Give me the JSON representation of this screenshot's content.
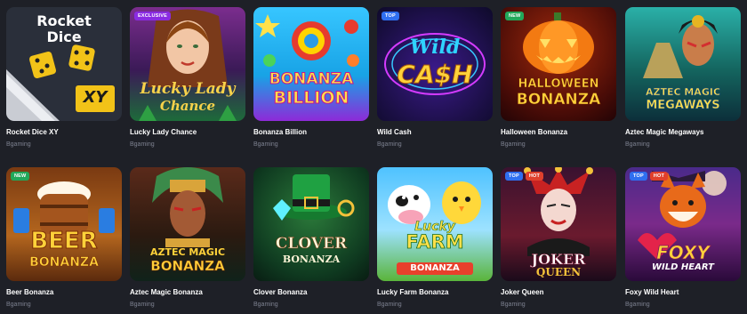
{
  "games": [
    {
      "title": "Rocket Dice XY",
      "provider": "Bgaming",
      "badges": [],
      "art": {
        "line1": "Rocket",
        "line2": "Dice",
        "line3": "XY"
      }
    },
    {
      "title": "Lucky Lady Chance",
      "provider": "Bgaming",
      "badges": [
        "EXCLUSIVE"
      ],
      "art": {
        "line1": "Lucky Lady",
        "line2": "Chance"
      }
    },
    {
      "title": "Bonanza Billion",
      "provider": "Bgaming",
      "badges": [],
      "art": {
        "line1": "BONANZA",
        "line2": "BILLION"
      }
    },
    {
      "title": "Wild Cash",
      "provider": "Bgaming",
      "badges": [
        "TOP"
      ],
      "art": {
        "line1": "Wild",
        "line2": "CA$H"
      }
    },
    {
      "title": "Halloween Bonanza",
      "provider": "Bgaming",
      "badges": [
        "NEW"
      ],
      "art": {
        "line1": "HALLOWEEN",
        "line2": "BONANZA"
      }
    },
    {
      "title": "Aztec Magic Megaways",
      "provider": "Bgaming",
      "badges": [],
      "art": {
        "line1": "AZTEC MAGIC",
        "line2": "MEGAWAYS"
      }
    },
    {
      "title": "Beer Bonanza",
      "provider": "Bgaming",
      "badges": [
        "NEW"
      ],
      "art": {
        "line1": "BEER",
        "line2": "BONANZA"
      }
    },
    {
      "title": "Aztec Magic Bonanza",
      "provider": "Bgaming",
      "badges": [],
      "art": {
        "line1": "AZTEC MAGIC",
        "line2": "BONANZA"
      }
    },
    {
      "title": "Clover Bonanza",
      "provider": "Bgaming",
      "badges": [],
      "art": {
        "line1": "CLOVER",
        "line2": "BONANZA"
      }
    },
    {
      "title": "Lucky Farm Bonanza",
      "provider": "Bgaming",
      "badges": [],
      "art": {
        "line1": "Lucky",
        "line2": "FARM",
        "line3": "BONANZA"
      }
    },
    {
      "title": "Joker Queen",
      "provider": "Bgaming",
      "badges": [
        "TOP",
        "HOT"
      ],
      "art": {
        "line1": "JOKER",
        "line2": "QUEEN"
      }
    },
    {
      "title": "Foxy Wild Heart",
      "provider": "Bgaming",
      "badges": [
        "TOP",
        "HOT"
      ],
      "art": {
        "line1": "FOXY",
        "line2": "WILD HEART"
      }
    }
  ],
  "colors": {
    "page_bg": "#1e2027",
    "provider_text": "#7d8190",
    "new": "#22a85a",
    "top": "#2f6ff0",
    "hot": "#e0402c",
    "exclusive": "#8a2be2"
  }
}
